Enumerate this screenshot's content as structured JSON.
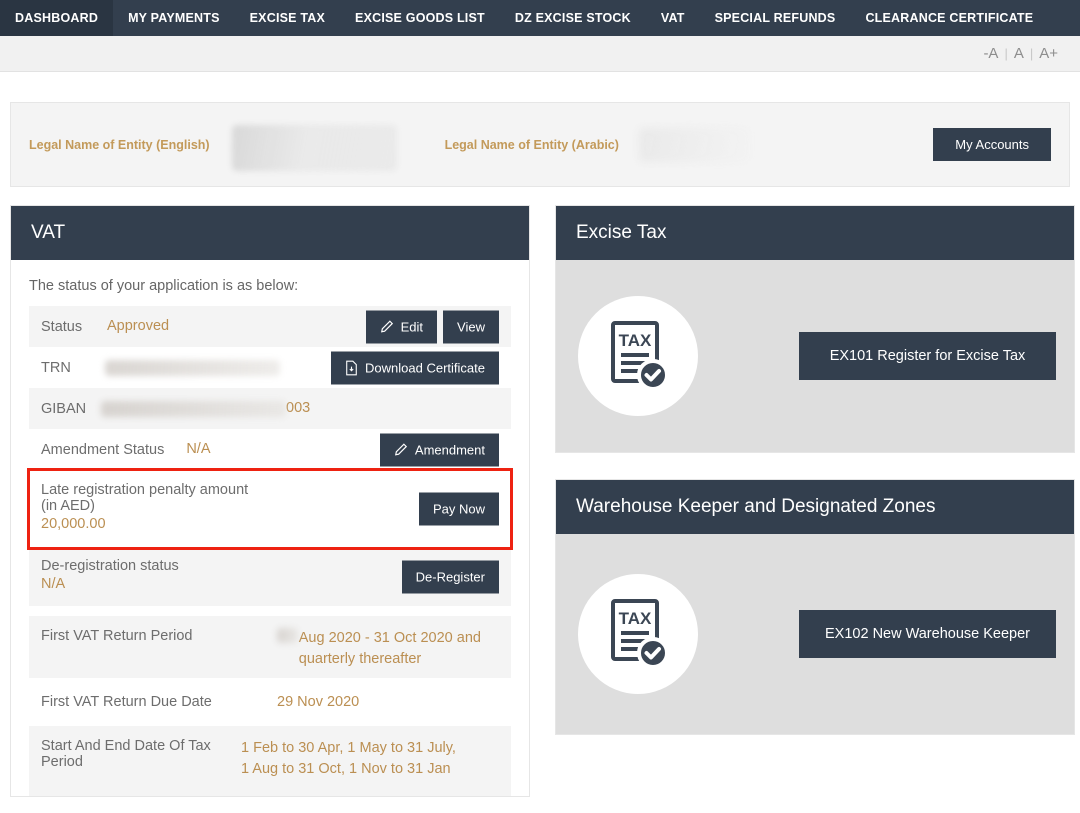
{
  "nav": {
    "items": [
      {
        "label": "DASHBOARD",
        "active": true
      },
      {
        "label": "MY PAYMENTS",
        "active": false
      },
      {
        "label": "EXCISE TAX",
        "active": false
      },
      {
        "label": "EXCISE GOODS LIST",
        "active": false
      },
      {
        "label": "DZ EXCISE STOCK",
        "active": false
      },
      {
        "label": "VAT",
        "active": false
      },
      {
        "label": "SPECIAL REFUNDS",
        "active": false
      },
      {
        "label": "CLEARANCE CERTIFICATE",
        "active": false
      }
    ]
  },
  "font_size_control": {
    "decrease": "-A",
    "normal": "A",
    "increase": "A+",
    "separator": "|"
  },
  "banner": {
    "label_english": "Legal Name of Entity (English)",
    "label_arabic": "Legal Name of Entity (Arabic)",
    "my_accounts_button": "My Accounts"
  },
  "vat": {
    "title": "VAT",
    "intro": "The status of your application is as below:",
    "rows": [
      {
        "label": "Status",
        "value": "Approved",
        "buttons": [
          "Edit",
          "View"
        ]
      },
      {
        "label": "TRN",
        "value": "",
        "redacted": true,
        "buttons": [
          "Download Certificate"
        ]
      },
      {
        "label": "GIBAN",
        "value": "003",
        "redacted": true,
        "buttons": []
      },
      {
        "label": "Amendment Status",
        "value": "N/A",
        "buttons": [
          "Amendment"
        ]
      },
      {
        "label": "Late registration penalty amount (in AED)",
        "value": "20,000.00",
        "highlighted": true,
        "buttons": [
          "Pay Now"
        ]
      },
      {
        "label": "De-registration status",
        "value": "N/A",
        "buttons": [
          "De-Register"
        ]
      },
      {
        "label": "First VAT Return Period",
        "value": "Aug 2020 - 31 Oct 2020 and quarterly thereafter",
        "redacted_prefix": true,
        "buttons": []
      },
      {
        "label": "First VAT Return Due Date",
        "value": "29 Nov 2020",
        "buttons": []
      },
      {
        "label": "Start And End Date Of Tax Period",
        "value": "1 Feb to 30 Apr, 1 May to 31 July, 1 Aug to 31 Oct, 1 Nov to 31 Jan",
        "buttons": []
      }
    ],
    "button_labels": {
      "edit": "Edit",
      "view": "View",
      "download_certificate": "Download Certificate",
      "amendment": "Amendment",
      "pay_now": "Pay Now",
      "de_register": "De-Register"
    }
  },
  "excise_tax_panel": {
    "title": "Excise Tax",
    "icon": "tax-document-check-icon",
    "icon_text": "TAX",
    "button": "EX101 Register for Excise Tax"
  },
  "warehouse_panel": {
    "title": "Warehouse Keeper and Designated Zones",
    "icon": "tax-document-check-icon",
    "icon_text": "TAX",
    "button": "EX102 New Warehouse Keeper"
  },
  "colors": {
    "header_dark": "#333f4e",
    "accent_gold": "#bb8f52",
    "banner_label_gold": "#c39a5a",
    "highlight_red": "#ee2211",
    "panel_grey": "#dedede",
    "row_shade": "#f4f4f4"
  }
}
